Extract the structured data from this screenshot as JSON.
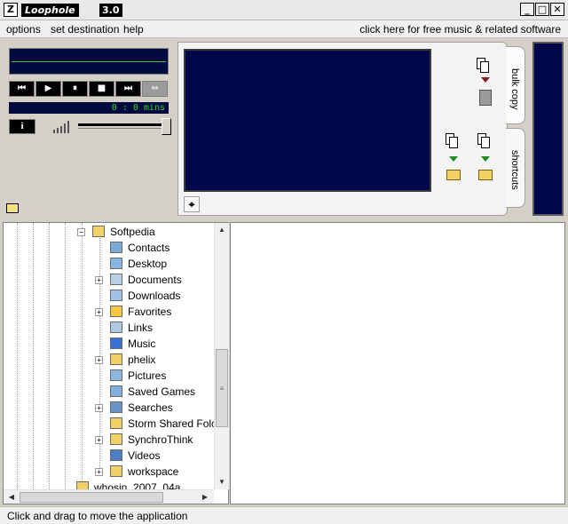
{
  "window": {
    "app_icon": "Z",
    "app_name": "Loophole",
    "version": "3.0",
    "controls": {
      "minimize": "_",
      "maximize": "□",
      "close": "✕"
    }
  },
  "menu": {
    "items": [
      {
        "label": "options"
      },
      {
        "label": "set destination"
      },
      {
        "label": "help"
      }
    ],
    "promo_link": "click here for free music & related software"
  },
  "player": {
    "time_display": "0 : 0 mins",
    "volume_level": 0.0,
    "transport": {
      "previous": "⏮",
      "play": "▶",
      "pause": "⏸",
      "stop": "■",
      "next": "⏭",
      "repeat": "⇔"
    },
    "info_label": "i"
  },
  "tabs": [
    {
      "label": "bulk copy"
    },
    {
      "label": "shortcuts"
    }
  ],
  "icons": {
    "copy_to_trash": "trash-icon",
    "copy_to_archive": "zip-folder-icon",
    "copy_to_folder": "folder-icon",
    "crosshair": "⌖"
  },
  "tree": {
    "items": [
      {
        "label": "Softpedia",
        "icon": "folder",
        "expander": "−"
      },
      {
        "label": "Contacts",
        "icon": "contacts",
        "expander": ""
      },
      {
        "label": "Desktop",
        "icon": "desktop",
        "expander": ""
      },
      {
        "label": "Documents",
        "icon": "documents",
        "expander": "+"
      },
      {
        "label": "Downloads",
        "icon": "downloads",
        "expander": ""
      },
      {
        "label": "Favorites",
        "icon": "favorites",
        "expander": "+"
      },
      {
        "label": "Links",
        "icon": "links",
        "expander": ""
      },
      {
        "label": "Music",
        "icon": "music",
        "expander": ""
      },
      {
        "label": "phelix",
        "icon": "folder",
        "expander": "+"
      },
      {
        "label": "Pictures",
        "icon": "pictures",
        "expander": ""
      },
      {
        "label": "Saved Games",
        "icon": "saved-games",
        "expander": ""
      },
      {
        "label": "Searches",
        "icon": "searches",
        "expander": "+"
      },
      {
        "label": "Storm Shared Folc",
        "icon": "folder",
        "expander": ""
      },
      {
        "label": "SynchroThink",
        "icon": "folder",
        "expander": "+"
      },
      {
        "label": "Videos",
        "icon": "videos",
        "expander": ""
      },
      {
        "label": "workspace",
        "icon": "folder",
        "expander": "+"
      },
      {
        "label": "whosin_2007_04a",
        "icon": "folder",
        "expander": ""
      }
    ]
  },
  "colors": {
    "lcd_bg": "#000a3e",
    "lcd_text": "#2fd72f",
    "screen_bg": "#00064a",
    "chrome_bg": "#d4d0c8"
  },
  "status": {
    "text": "Click and drag to move the application"
  }
}
